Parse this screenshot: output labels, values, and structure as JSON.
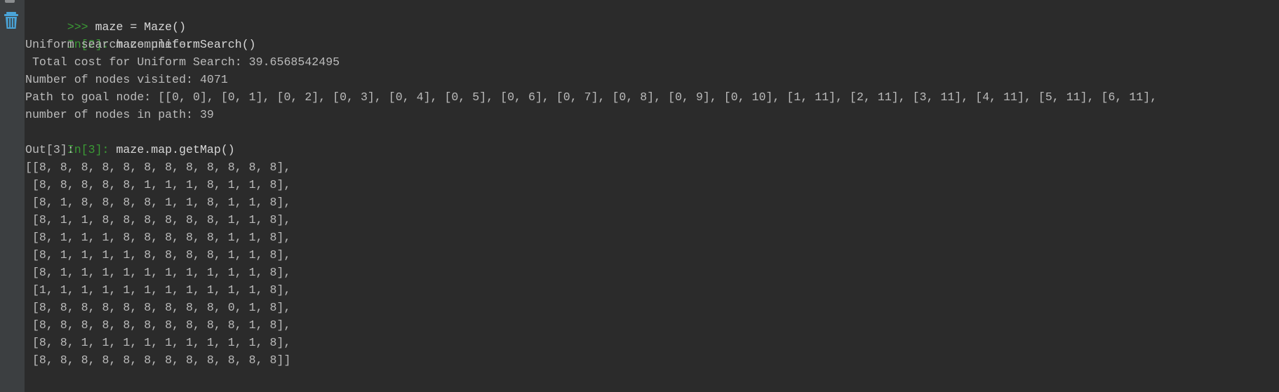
{
  "gutter": {
    "trash_icon": "trash-icon"
  },
  "console": {
    "lines": [
      {
        "prompt": ">>> ",
        "code": "maze = Maze()"
      },
      {
        "prompt": "In[2]: ",
        "code": "maze.uniformSearch()"
      },
      {
        "text": "Uniform search complete."
      },
      {
        "text": " Total cost for Uniform Search: 39.6568542495"
      },
      {
        "text": "Number of nodes visited: 4071"
      },
      {
        "text": "Path to goal node: [[0, 0], [0, 1], [0, 2], [0, 3], [0, 4], [0, 5], [0, 6], [0, 7], [0, 8], [0, 9], [0, 10], [1, 11], [2, 11], [3, 11], [4, 11], [5, 11], [6, 11],"
      },
      {
        "text": "number of nodes in path: 39"
      },
      {
        "prompt": "In[3]: ",
        "code": "maze.map.getMap()"
      },
      {
        "text": "Out[3]:"
      }
    ],
    "map_rows": [
      "[[8, 8, 8, 8, 8, 8, 8, 8, 8, 8, 8, 8],",
      " [8, 8, 8, 8, 8, 1, 1, 1, 8, 1, 1, 8],",
      " [8, 1, 8, 8, 8, 8, 1, 1, 8, 1, 1, 8],",
      " [8, 1, 1, 8, 8, 8, 8, 8, 8, 1, 1, 8],",
      " [8, 1, 1, 1, 8, 8, 8, 8, 8, 1, 1, 8],",
      " [8, 1, 1, 1, 1, 8, 8, 8, 8, 1, 1, 8],",
      " [8, 1, 1, 1, 1, 1, 1, 1, 1, 1, 1, 8],",
      " [1, 1, 1, 1, 1, 1, 1, 1, 1, 1, 1, 8],",
      " [8, 8, 8, 8, 8, 8, 8, 8, 8, 0, 1, 8],",
      " [8, 8, 8, 8, 8, 8, 8, 8, 8, 8, 1, 8],",
      " [8, 8, 1, 1, 1, 1, 1, 1, 1, 1, 1, 8],",
      " [8, 8, 8, 8, 8, 8, 8, 8, 8, 8, 8, 8]]"
    ]
  }
}
